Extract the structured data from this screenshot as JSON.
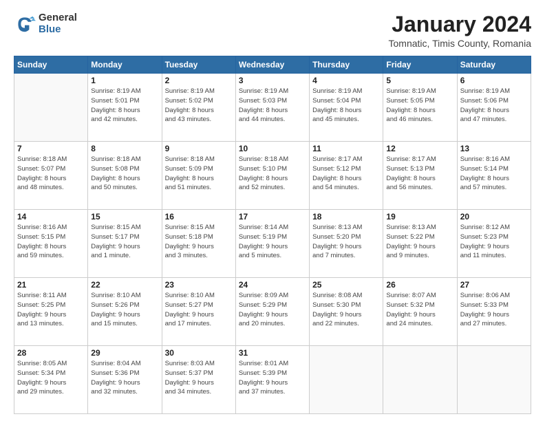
{
  "header": {
    "logo_general": "General",
    "logo_blue": "Blue",
    "title": "January 2024",
    "location": "Tomnatic, Timis County, Romania"
  },
  "weekdays": [
    "Sunday",
    "Monday",
    "Tuesday",
    "Wednesday",
    "Thursday",
    "Friday",
    "Saturday"
  ],
  "weeks": [
    [
      {
        "day": "",
        "info": ""
      },
      {
        "day": "1",
        "info": "Sunrise: 8:19 AM\nSunset: 5:01 PM\nDaylight: 8 hours\nand 42 minutes."
      },
      {
        "day": "2",
        "info": "Sunrise: 8:19 AM\nSunset: 5:02 PM\nDaylight: 8 hours\nand 43 minutes."
      },
      {
        "day": "3",
        "info": "Sunrise: 8:19 AM\nSunset: 5:03 PM\nDaylight: 8 hours\nand 44 minutes."
      },
      {
        "day": "4",
        "info": "Sunrise: 8:19 AM\nSunset: 5:04 PM\nDaylight: 8 hours\nand 45 minutes."
      },
      {
        "day": "5",
        "info": "Sunrise: 8:19 AM\nSunset: 5:05 PM\nDaylight: 8 hours\nand 46 minutes."
      },
      {
        "day": "6",
        "info": "Sunrise: 8:19 AM\nSunset: 5:06 PM\nDaylight: 8 hours\nand 47 minutes."
      }
    ],
    [
      {
        "day": "7",
        "info": "Sunrise: 8:18 AM\nSunset: 5:07 PM\nDaylight: 8 hours\nand 48 minutes."
      },
      {
        "day": "8",
        "info": "Sunrise: 8:18 AM\nSunset: 5:08 PM\nDaylight: 8 hours\nand 50 minutes."
      },
      {
        "day": "9",
        "info": "Sunrise: 8:18 AM\nSunset: 5:09 PM\nDaylight: 8 hours\nand 51 minutes."
      },
      {
        "day": "10",
        "info": "Sunrise: 8:18 AM\nSunset: 5:10 PM\nDaylight: 8 hours\nand 52 minutes."
      },
      {
        "day": "11",
        "info": "Sunrise: 8:17 AM\nSunset: 5:12 PM\nDaylight: 8 hours\nand 54 minutes."
      },
      {
        "day": "12",
        "info": "Sunrise: 8:17 AM\nSunset: 5:13 PM\nDaylight: 8 hours\nand 56 minutes."
      },
      {
        "day": "13",
        "info": "Sunrise: 8:16 AM\nSunset: 5:14 PM\nDaylight: 8 hours\nand 57 minutes."
      }
    ],
    [
      {
        "day": "14",
        "info": "Sunrise: 8:16 AM\nSunset: 5:15 PM\nDaylight: 8 hours\nand 59 minutes."
      },
      {
        "day": "15",
        "info": "Sunrise: 8:15 AM\nSunset: 5:17 PM\nDaylight: 9 hours\nand 1 minute."
      },
      {
        "day": "16",
        "info": "Sunrise: 8:15 AM\nSunset: 5:18 PM\nDaylight: 9 hours\nand 3 minutes."
      },
      {
        "day": "17",
        "info": "Sunrise: 8:14 AM\nSunset: 5:19 PM\nDaylight: 9 hours\nand 5 minutes."
      },
      {
        "day": "18",
        "info": "Sunrise: 8:13 AM\nSunset: 5:20 PM\nDaylight: 9 hours\nand 7 minutes."
      },
      {
        "day": "19",
        "info": "Sunrise: 8:13 AM\nSunset: 5:22 PM\nDaylight: 9 hours\nand 9 minutes."
      },
      {
        "day": "20",
        "info": "Sunrise: 8:12 AM\nSunset: 5:23 PM\nDaylight: 9 hours\nand 11 minutes."
      }
    ],
    [
      {
        "day": "21",
        "info": "Sunrise: 8:11 AM\nSunset: 5:25 PM\nDaylight: 9 hours\nand 13 minutes."
      },
      {
        "day": "22",
        "info": "Sunrise: 8:10 AM\nSunset: 5:26 PM\nDaylight: 9 hours\nand 15 minutes."
      },
      {
        "day": "23",
        "info": "Sunrise: 8:10 AM\nSunset: 5:27 PM\nDaylight: 9 hours\nand 17 minutes."
      },
      {
        "day": "24",
        "info": "Sunrise: 8:09 AM\nSunset: 5:29 PM\nDaylight: 9 hours\nand 20 minutes."
      },
      {
        "day": "25",
        "info": "Sunrise: 8:08 AM\nSunset: 5:30 PM\nDaylight: 9 hours\nand 22 minutes."
      },
      {
        "day": "26",
        "info": "Sunrise: 8:07 AM\nSunset: 5:32 PM\nDaylight: 9 hours\nand 24 minutes."
      },
      {
        "day": "27",
        "info": "Sunrise: 8:06 AM\nSunset: 5:33 PM\nDaylight: 9 hours\nand 27 minutes."
      }
    ],
    [
      {
        "day": "28",
        "info": "Sunrise: 8:05 AM\nSunset: 5:34 PM\nDaylight: 9 hours\nand 29 minutes."
      },
      {
        "day": "29",
        "info": "Sunrise: 8:04 AM\nSunset: 5:36 PM\nDaylight: 9 hours\nand 32 minutes."
      },
      {
        "day": "30",
        "info": "Sunrise: 8:03 AM\nSunset: 5:37 PM\nDaylight: 9 hours\nand 34 minutes."
      },
      {
        "day": "31",
        "info": "Sunrise: 8:01 AM\nSunset: 5:39 PM\nDaylight: 9 hours\nand 37 minutes."
      },
      {
        "day": "",
        "info": ""
      },
      {
        "day": "",
        "info": ""
      },
      {
        "day": "",
        "info": ""
      }
    ]
  ]
}
